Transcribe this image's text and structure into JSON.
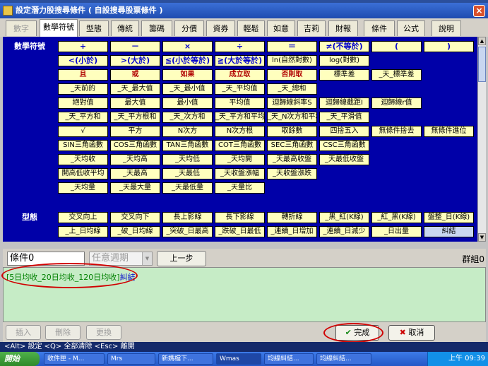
{
  "window": {
    "title": "設定潛力股搜尋條件 ( 自設搜尋股票條件 )",
    "close": "×"
  },
  "tabs": [
    {
      "label": "數字",
      "disabled": true
    },
    {
      "label": "數學符號",
      "active": true
    },
    {
      "label": "型態"
    },
    {
      "label": "傳統"
    },
    {
      "label": "籌碼"
    },
    {
      "label": "分價"
    },
    {
      "label": "資券"
    },
    {
      "label": "輕鬆"
    },
    {
      "label": "如意"
    },
    {
      "label": "吉莉"
    },
    {
      "label": "財報"
    },
    {
      "label": "條件"
    },
    {
      "label": "公式"
    },
    {
      "label": "說明"
    }
  ],
  "grid": {
    "cat1": "數學符號",
    "cat2": "型態",
    "rows": [
      [
        "+",
        "－",
        "×",
        "÷",
        "＝",
        "≠(不等於)",
        "(",
        ")"
      ],
      [
        "<(小於)",
        ">(大於)",
        "≦(小於等於)",
        "≧(大於等於)",
        "ln(自然對數)",
        "log(對數)"
      ],
      [
        "且",
        "或",
        "如果",
        "成立取",
        "否則取",
        "標準差",
        "_天_標準差"
      ],
      [
        "_天前的",
        "_天_最大值",
        "_天_最小值",
        "_天_平均值",
        "_天_總和"
      ],
      [
        "絕對值",
        "最大值",
        "最小值",
        "平均值",
        "迴歸線斜率S",
        "迴歸線截距I",
        "迴歸線r值"
      ],
      [
        "_天_平方和",
        "_天_平方根和",
        "_天_次方和",
        "_天_平方和平均",
        "_天_N次方和平均",
        "_天_平滑值"
      ],
      [
        "√",
        "平方",
        "N次方",
        "N次方根",
        "取餘數",
        "四捨五入",
        "無條件捨去",
        "無條件進位"
      ],
      [
        "SIN三角函數",
        "COS三角函數",
        "TAN三角函數",
        "COT三角函數",
        "SEC三角函數",
        "CSC三角函數"
      ],
      [
        "_天均收",
        "_天均高",
        "_天均低",
        "_天均開",
        "_天最高收盤",
        "_天最低收盤"
      ],
      [
        "開高低收平均",
        "_天最高",
        "_天最低",
        "_天收盤漲幅",
        "_天收盤漲跌"
      ],
      [
        "_天均量",
        "_天最大量",
        "_天最低量",
        "_天量比"
      ]
    ],
    "pattern_rows": [
      [
        "交叉向上",
        "交叉向下",
        "長上影線",
        "長下影線",
        "轉折線",
        "_黑_紅(K線)",
        "_紅_黑(K線)",
        "盤整_日(K線)"
      ],
      [
        "_上_日均線",
        "_破_日均線",
        "_突破_日最高",
        "_跌破_日最低",
        "_連續_日增加",
        "_連續_日減少",
        "_日出量",
        "糾結"
      ]
    ]
  },
  "condition": {
    "field_value": "條件0",
    "period_value": "任意週期",
    "prev_label": "上一步",
    "group_label": "群組0"
  },
  "formula": {
    "text_green": "[5日均收_20日均收_120日均收]",
    "text_blue": "糾結"
  },
  "buttons": {
    "insert": "插入",
    "delete": "刪除",
    "replace": "更換",
    "ok": "完成",
    "cancel": "取消"
  },
  "background_strip": "<Alt> 設定   <Q> 全部清除   <Esc> 離開",
  "taskbar": {
    "start": "開始",
    "items": [
      "收件匣 - M...",
      "Mrs",
      "新媽檔下...",
      "Wmas",
      "均線糾結...",
      "均線糾結..."
    ],
    "clock": "上午 09:39"
  }
}
